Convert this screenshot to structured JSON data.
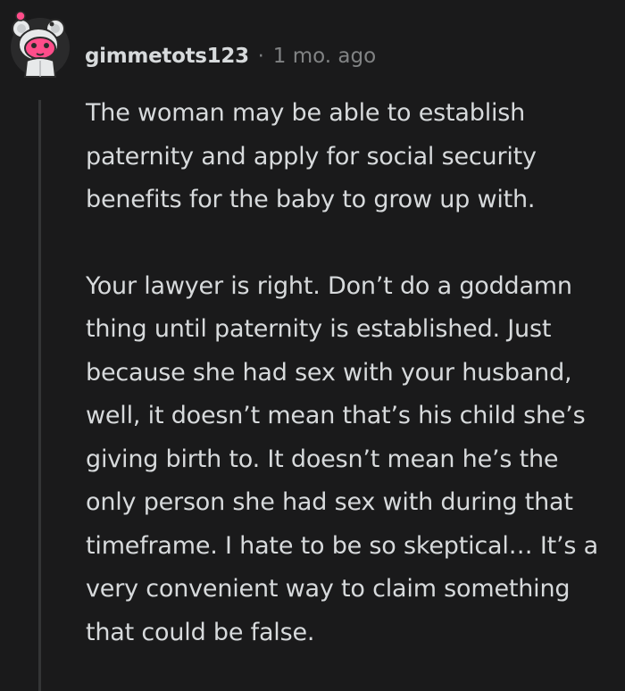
{
  "comment": {
    "username": "gimmetots123",
    "separator": "·",
    "timestamp": "1 mo. ago",
    "paragraphs": [
      "The woman may be able to establish paternity and apply for social security benefits for the baby to grow up with.",
      "Your lawyer is right. Don’t do a goddamn thing until paternity is established. Just because she had sex with your husband, well, it doesn’t mean that’s his child she’s giving birth to. It doesn’t mean he’s the only person she had sex with during that timeframe. I hate to be so skeptical… It’s a very convenient way to claim something that could be false."
    ]
  },
  "avatar": {
    "icon": "snoo-avatar-icon",
    "colors": {
      "body": "#e7e9ea",
      "face": "#ff4d8a",
      "bow": "#ff4d8a",
      "outline": "#2b2b2b"
    }
  },
  "colors": {
    "background": "#1a1a1b",
    "text": "#d7dadc",
    "muted": "#818384",
    "thread_line": "#343536"
  }
}
